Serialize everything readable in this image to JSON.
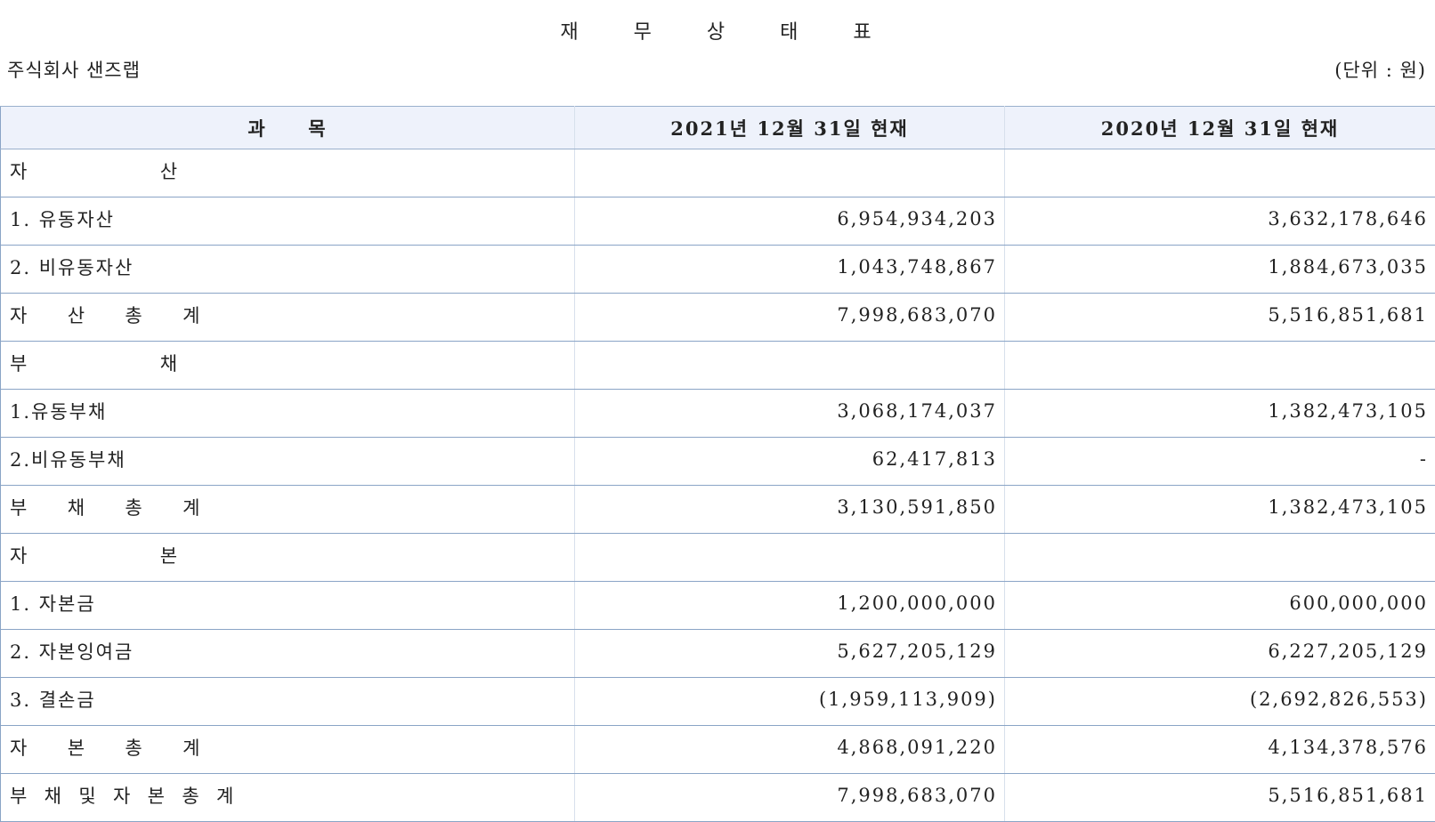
{
  "header": {
    "title": "재  무  상  태  표",
    "company": "주식회사 샌즈랩",
    "unit": "(단위 : 원)"
  },
  "table": {
    "columns": [
      "과     목",
      "2021년 12월 31일 현재",
      "2020년 12월 31일 현재"
    ],
    "rows": [
      {
        "label": "자                 산",
        "y2021": "",
        "y2020": ""
      },
      {
        "label": "1. 유동자산",
        "y2021": "6,954,934,203",
        "y2020": "3,632,178,646"
      },
      {
        "label": "2. 비유동자산",
        "y2021": "1,043,748,867",
        "y2020": "1,884,673,035"
      },
      {
        "label": "자     산     총     계",
        "y2021": "7,998,683,070",
        "y2020": "5,516,851,681"
      },
      {
        "label": "부                 채",
        "y2021": "",
        "y2020": ""
      },
      {
        "label": "1.유동부채",
        "y2021": "3,068,174,037",
        "y2020": "1,382,473,105"
      },
      {
        "label": "2.비유동부채",
        "y2021": "62,417,813",
        "y2020": "-"
      },
      {
        "label": "부     채     총     계",
        "y2021": "3,130,591,850",
        "y2020": "1,382,473,105"
      },
      {
        "label": "자                 본",
        "y2021": "",
        "y2020": ""
      },
      {
        "label": "1. 자본금",
        "y2021": "1,200,000,000",
        "y2020": "600,000,000"
      },
      {
        "label": "2. 자본잉여금",
        "y2021": "5,627,205,129",
        "y2020": "6,227,205,129"
      },
      {
        "label": "3. 결손금",
        "y2021": "(1,959,113,909)",
        "y2020": "(2,692,826,553)"
      },
      {
        "label": "자     본     총     계",
        "y2021": "4,868,091,220",
        "y2020": "4,134,378,576"
      },
      {
        "label": "부  채  및  자  본  총  계",
        "y2021": "7,998,683,070",
        "y2020": "5,516,851,681"
      }
    ]
  }
}
